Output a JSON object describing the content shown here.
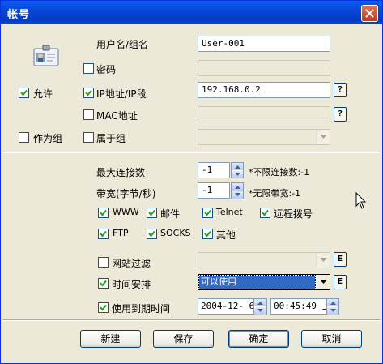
{
  "window": {
    "title": "帐号"
  },
  "labels": {
    "username": "用户名/组名",
    "password": "密码",
    "allow": "允许",
    "ip": "IP地址/IP段",
    "mac": "MAC地址",
    "as_group": "作为组",
    "belongs_group": "属于组",
    "max_conn": "最大连接数",
    "max_conn_hint": "*不限连接数:-1",
    "bandwidth": "带宽(字节/秒)",
    "bandwidth_hint": "*无限带宽:-1",
    "www": "WWW",
    "mail": "邮件",
    "telnet": "Telnet",
    "remote_dial": "远程拨号",
    "ftp": "FTP",
    "socks": "SOCKS",
    "other": "其他",
    "site_filter": "网站过滤",
    "time_schedule": "时间安排",
    "expiry": "使用到期时间"
  },
  "fields": {
    "username": "User-001",
    "password": "",
    "ip": "192.168.0.2",
    "mac": "",
    "max_conn": "-1",
    "bandwidth": "-1",
    "schedule": "可以使用",
    "expiry_date": "2004-12- 6",
    "expiry_time": "00:45:49 上"
  },
  "checks": {
    "password": false,
    "allow": true,
    "ip": true,
    "mac": false,
    "as_group": false,
    "belongs_group": false,
    "www": true,
    "mail": true,
    "telnet": true,
    "remote_dial": true,
    "ftp": true,
    "socks": true,
    "other": true,
    "site_filter": false,
    "time_schedule": true,
    "expiry": true
  },
  "small_buttons": {
    "help": "?",
    "edit": "E"
  },
  "buttons": {
    "new": "新建",
    "save": "保存",
    "ok": "确定",
    "cancel": "取消"
  }
}
